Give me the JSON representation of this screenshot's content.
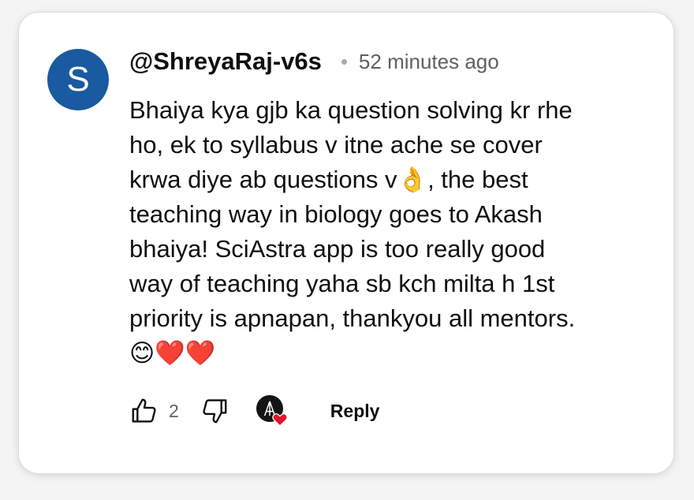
{
  "comment": {
    "avatar_letter": "S",
    "author": "@ShreyaRaj-v6s",
    "separator": "•",
    "time": "52 minutes ago",
    "text_lines": [
      "Bhaiya kya gjb ka question solving kr rhe",
      "ho, ek to syllabus v itne ache se cover",
      "krwa diye ab questions v",
      "👌",
      ", the best",
      "teaching way in biology goes to Akash",
      "bhaiya! SciAstra app is too really good",
      "way of teaching yaha sb kch milta h 1st",
      "priority is apnapan, thankyou all mentors.",
      "😊❤️❤️"
    ],
    "like_count": "2",
    "reply_label": "Reply"
  },
  "icons": {
    "like": "thumbs-up-icon",
    "dislike": "thumbs-down-icon",
    "creator_heart": "creator-heart-icon"
  },
  "colors": {
    "avatar_bg": "#1a5aa0",
    "heart": "#e0142b",
    "muted_text": "#606060"
  }
}
